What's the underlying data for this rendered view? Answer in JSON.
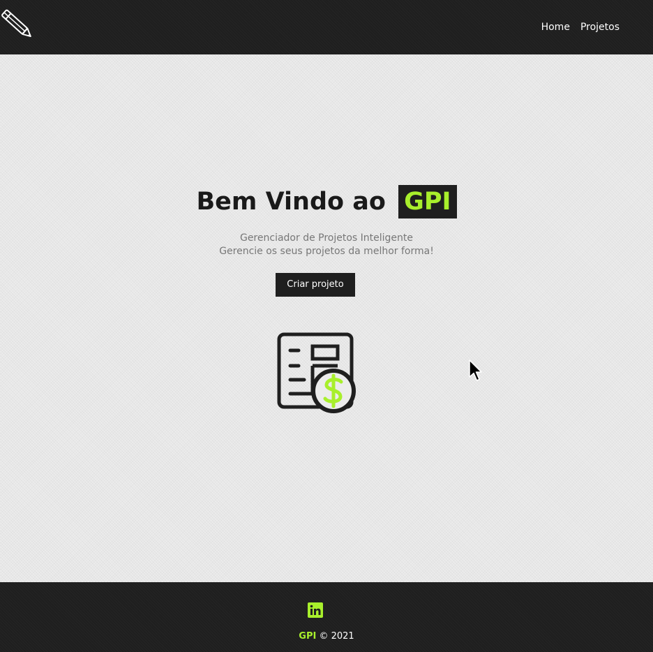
{
  "navbar": {
    "logo_icon": "pencil-icon",
    "links": [
      {
        "label": "Home"
      },
      {
        "label": "Projetos"
      }
    ]
  },
  "hero": {
    "title_prefix": "Bem Vindo ao",
    "title_brand": "GPI",
    "subtitle_line1": "Gerenciador de Projetos Inteligente",
    "subtitle_line2": "Gerencie os seus projetos da melhor forma!",
    "cta_label": "Criar projeto",
    "illustration_icon": "project-budget-icon"
  },
  "footer": {
    "social_icon": "linkedin-icon",
    "brand": "GPI",
    "copyright": "© 2021"
  },
  "colors": {
    "dark": "#1f1f1f",
    "accent": "#a8ef2c",
    "background": "#ececec",
    "muted_text": "#777777"
  }
}
